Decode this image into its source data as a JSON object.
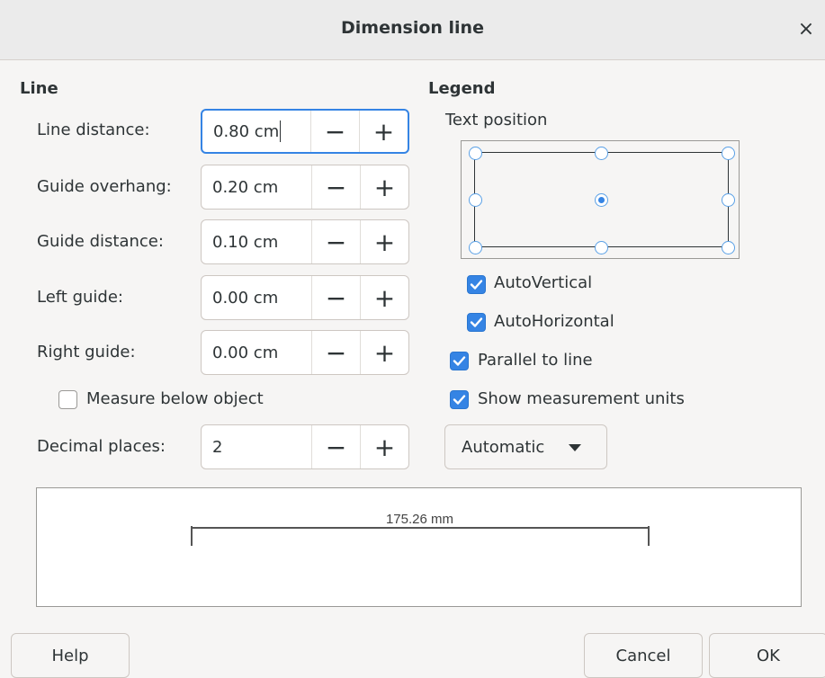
{
  "window": {
    "title": "Dimension line",
    "close_glyph": "×"
  },
  "line_section": {
    "title": "Line",
    "fields": [
      {
        "label": "Line distance:",
        "value": "0.80 cm"
      },
      {
        "label": "Guide overhang:",
        "value": "0.20 cm"
      },
      {
        "label": "Guide distance:",
        "value": "0.10 cm"
      },
      {
        "label": "Left guide:",
        "value": "0.00 cm"
      },
      {
        "label": "Right guide:",
        "value": "0.00 cm"
      }
    ],
    "measure_below": {
      "label": "Measure below object",
      "checked": false
    },
    "decimal_places": {
      "label": "Decimal places:",
      "value": "2"
    },
    "spin_minus": "−",
    "spin_plus": "+"
  },
  "legend_section": {
    "title": "Legend",
    "text_position_label": "Text position",
    "selected_position": "center",
    "auto_vertical": {
      "label": "AutoVertical",
      "checked": true
    },
    "auto_horizontal": {
      "label": "AutoHorizontal",
      "checked": true
    },
    "parallel_to_line": {
      "label": "Parallel to line",
      "checked": true
    },
    "show_units": {
      "label": "Show measurement units",
      "checked": true
    },
    "units_dropdown": {
      "value": "Automatic",
      "icon": "triangle-down-icon"
    }
  },
  "preview": {
    "measurement_text": "175.26 mm"
  },
  "buttons": {
    "help": "Help",
    "cancel": "Cancel",
    "ok": "OK"
  },
  "colors": {
    "accent": "#3584e4",
    "radio_border": "#5aa0e6"
  }
}
